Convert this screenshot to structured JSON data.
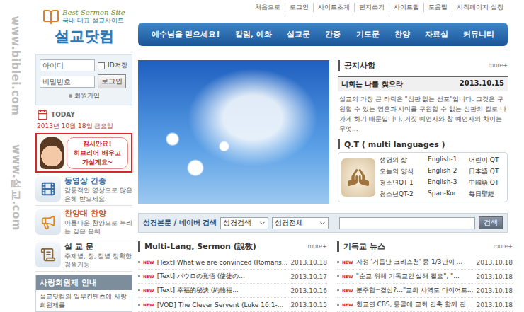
{
  "watermarks": [
    "www.biblei.com",
    "www.설교.com"
  ],
  "logo": {
    "tagline": "Best Sermon Site",
    "subtitle": "국내 대표 설교사이트",
    "name": "설교닷컴"
  },
  "top_links": [
    "처음으로",
    "로그인",
    "사이트초계",
    "편지쓰기",
    "사이트맵",
    "도움말",
    "시작페이지 설정"
  ],
  "nav": [
    "예수님을 믿으세요!",
    "칼럼, 예화",
    "설교문",
    "간증",
    "기도문",
    "찬양",
    "자료실",
    "커뮤니티"
  ],
  "login": {
    "id_placeholder": "아이디",
    "save_id_label": "ID저장",
    "save_id_checked": false,
    "pw_placeholder": "비밀번호",
    "button": "로그인",
    "join": "회원가입"
  },
  "today": {
    "label": "TODAY",
    "date": "2013년 10월 18일 금요일"
  },
  "ad_banner": {
    "lines": [
      "잠시만요!",
      "히브리어 배우고",
      "가실게요~"
    ]
  },
  "sidebar_items": [
    {
      "kind": "video",
      "title": "동영상 간증",
      "desc": "감동적인 영상으로 많은 은혜 받으세요.",
      "color": "#2a6fb0"
    },
    {
      "kind": "praise",
      "title": "찬양대 찬양",
      "desc": "아름다운 찬양으로 누리는 깊은 은혜",
      "color": "#d2562a"
    },
    {
      "kind": "sermon",
      "title": "설 교 문",
      "desc": "주제별, 장, 절별 정확한 검색기능",
      "color": "#333333"
    }
  ],
  "membership": {
    "title": "사랑회원제 안내",
    "desc": "설교닷컴의 일부컨텐츠에 사랑회원제를"
  },
  "notice": {
    "title": "공지사항",
    "more": "more+",
    "headline": "너희는 나를 찾으라",
    "date": "2013.10.15",
    "body": "설교의 가장 큰 타락은 \"심판 없는 선포\"입니다. 그것은 구원할 수 있는 영혼과 시며를 구원할 수 없는 심판의 길로 나가게 하기 때문입니다. 거짓 예언자와 참 예언자의 차이는 무엇..."
  },
  "qt": {
    "title": "Q.T ( multi languages )",
    "items": [
      "생명의 삶",
      "English-1",
      "어린이 QT",
      "오늘의 양식",
      "English-2",
      "日本語 QT",
      "청소년QT-1",
      "English-3",
      "中國語 QT",
      "청소년QT-2",
      "Span-Kor",
      "每日聖經"
    ]
  },
  "search": {
    "label": "성경본문 / 네이버 검색",
    "selects": [
      "성경검색",
      "성경전체"
    ],
    "button": "검색"
  },
  "sermons": {
    "title": "Multi-Lang, Sermon (說敎)",
    "more": "more+",
    "rows": [
      {
        "badge": "NEW",
        "title": "[Text] What we are convinced (Romans...",
        "date": "2013.10.18"
      },
      {
        "badge": "NEW",
        "title": "[Text] パウロの覚悟 (使徒の...",
        "date": "2013.10.17"
      },
      {
        "badge": "NEW",
        "title": "[Text] 幸福的秘訣 (約翰福...",
        "date": "2013.10.16"
      },
      {
        "badge": "NEW",
        "title": "[VOD] The Clever Servent (Luke 16:1-...",
        "date": "2013.10.15"
      }
    ]
  },
  "news": {
    "title": "기독교 뉴스",
    "more": "more+",
    "rows": [
      {
        "badge": "NEW",
        "title": "자정 '거듭난 크리스천' 중 1/3만이 ...",
        "date": "2013.10.18"
      },
      {
        "badge": "NEW",
        "title": "\"순교 위해 기독교인 살해 필요\", \"...",
        "date": "2013.10.18"
      },
      {
        "badge": "NEW",
        "title": "분주함=결심?…\"교회 사역도 다이어트...",
        "date": "2013.10.18"
      },
      {
        "badge": "NEW",
        "title": "한교연·CBS, 몽골에 교회 건축 함께 진...",
        "date": "2013.10.18"
      }
    ]
  }
}
